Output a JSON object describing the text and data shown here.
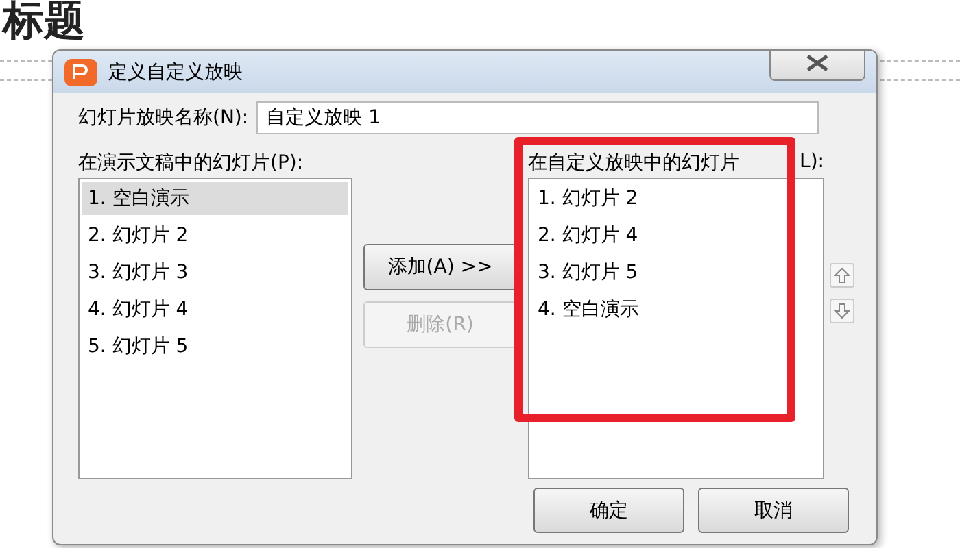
{
  "slide": {
    "title": "标题"
  },
  "dialog": {
    "title": "定义自定义放映",
    "name_label": "幻灯片放映名称(N):",
    "name_value": "自定义放映 1",
    "left_label": "在演示文稿中的幻灯片(P):",
    "left_items": [
      {
        "label": "1. 空白演示",
        "selected": true
      },
      {
        "label": "2. 幻灯片 2",
        "selected": false
      },
      {
        "label": "3. 幻灯片 3",
        "selected": false
      },
      {
        "label": "4. 幻灯片 4",
        "selected": false
      },
      {
        "label": "5. 幻灯片 5",
        "selected": false
      }
    ],
    "add_button": {
      "label": "添加(A) >>",
      "disabled": false
    },
    "remove_button": {
      "label": "删除(R)",
      "disabled": true
    },
    "right_label": [
      "在自定义放映中的幻灯片",
      "L):"
    ],
    "right_items": [
      {
        "label": "1. 幻灯片 2",
        "selected": false
      },
      {
        "label": "2. 幻灯片 4",
        "selected": false
      },
      {
        "label": "3. 幻灯片 5",
        "selected": false
      },
      {
        "label": "4. 空白演示",
        "selected": false
      }
    ],
    "buttons": [
      "确定",
      "取消"
    ]
  }
}
